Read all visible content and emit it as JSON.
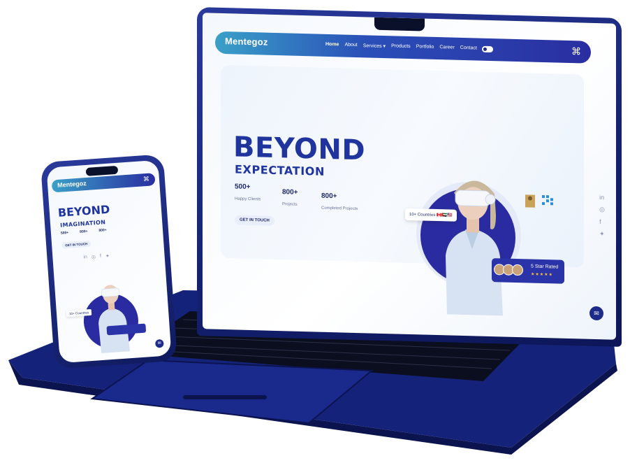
{
  "site": {
    "logo": "Mentegoz",
    "nav": [
      "Home",
      "About",
      "Services ▾",
      "Products",
      "Portfolio",
      "Career",
      "Contact"
    ],
    "menu_icon": "grid-icon"
  },
  "hero": {
    "title": "BEYOND",
    "subtitle": "EXPECTATION",
    "stats": [
      {
        "num": "500+",
        "label": "Happy Clients"
      },
      {
        "num": "800+",
        "label": "Projects"
      },
      {
        "num": "800+",
        "label": "Completed Projects"
      }
    ],
    "cta": "GET IN TOUCH",
    "countries_badge": "10+ Countries",
    "rated_badge": "5 Star Rated",
    "stars": "★★★★★"
  },
  "social_icons": [
    "linkedin-icon",
    "instagram-icon",
    "facebook-icon",
    "twitter-icon"
  ],
  "mobile": {
    "logo": "Mentegoz",
    "title": "BEYOND",
    "subtitle": "IMAGINATION",
    "stats": [
      "500+",
      "800+",
      "800+"
    ],
    "cta": "GET IN TOUCH",
    "countries_badge": "10+ Countries"
  },
  "colors": {
    "brand_blue": "#20349e",
    "device_blue": "#1d2a8a",
    "accent_cyan": "#3aa0c8",
    "star_gold": "#f6c238"
  }
}
